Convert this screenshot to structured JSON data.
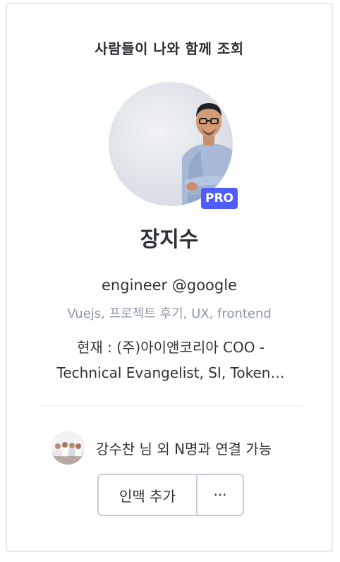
{
  "card": {
    "header_title": "사람들이 나와 함께 조회",
    "profile": {
      "badge": "PRO",
      "name": "장지수",
      "headline": "engineer @google",
      "tags": "Vuejs, 프로젝트 후기, UX, frontend",
      "current_line1": "현재 : (주)아이앤코리아 COO -",
      "current_line2": "Technical Evangelist, SI, Token…"
    },
    "mutual": {
      "text": "강수찬 님 외 N명과 연결 가능"
    },
    "actions": {
      "add_label": "인맥 추가",
      "more_label": "···"
    }
  },
  "colors": {
    "accent": "#4f5dff",
    "muted_text": "#8d96a6",
    "border": "#c7ccd6"
  },
  "icons": {
    "profile_avatar": "profile-photo-man-in-shirt",
    "mutual_avatar": "group-photo-thumbnail"
  }
}
